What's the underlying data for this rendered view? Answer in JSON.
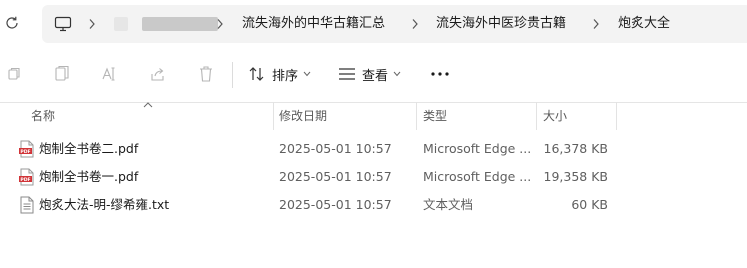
{
  "address_bar": {
    "crumbs": [
      "流失海外的中华古籍汇总",
      "流失海外中医珍贵古籍",
      "炮炙大全"
    ]
  },
  "toolbar": {
    "sort_label": "排序",
    "view_label": "查看"
  },
  "columns": {
    "name": "名称",
    "date": "修改日期",
    "type": "类型",
    "size": "大小"
  },
  "files": [
    {
      "name": "炮制全书卷二.pdf",
      "date": "2025-05-01 10:57",
      "type": "Microsoft Edge ...",
      "size": "16,378 KB",
      "icon": "pdf-file-icon"
    },
    {
      "name": "炮制全书卷一.pdf",
      "date": "2025-05-01 10:57",
      "type": "Microsoft Edge ...",
      "size": "19,358 KB",
      "icon": "pdf-file-icon"
    },
    {
      "name": "炮炙大法-明-缪希雍.txt",
      "date": "2025-05-01 10:57",
      "type": "文本文档",
      "size": "60 KB",
      "icon": "text-file-icon"
    }
  ],
  "colors": {
    "pdf_red": "#d13438",
    "address_bg": "#f3f3f3",
    "header_text": "#5a5a5a"
  }
}
